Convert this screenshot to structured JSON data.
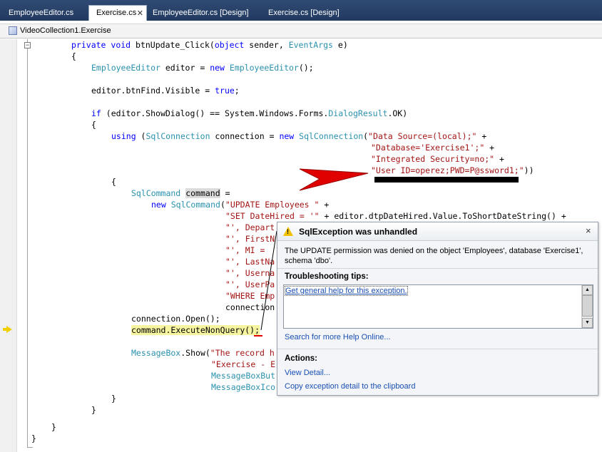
{
  "tabs": [
    {
      "label": "EmployeeEditor.cs",
      "active": false
    },
    {
      "label": "Exercise.cs",
      "active": true
    },
    {
      "label": "EmployeeEditor.cs [Design]",
      "active": false
    },
    {
      "label": "Exercise.cs [Design]",
      "active": false
    }
  ],
  "navbar": {
    "member": "VideoCollection1.Exercise"
  },
  "code": {
    "l01": {
      "a": "private",
      "b": "void",
      "c": " btnUpdate_Click(",
      "d": "object",
      "e": " sender, ",
      "f": "EventArgs",
      "g": " e)"
    },
    "l02": "{",
    "l03": {
      "a": "EmployeeEditor",
      "b": " editor = ",
      "c": "new",
      "d": " ",
      "e": "EmployeeEditor",
      "f": "();"
    },
    "l04": {
      "a": "editor.btnFind.Visible = ",
      "b": "true",
      "c": ";"
    },
    "l05": {
      "a": "if",
      "b": " (editor.ShowDialog() == System.Windows.Forms.",
      "c": "DialogResult",
      "d": ".OK)"
    },
    "l06": "{",
    "l07": {
      "a": "using",
      "b": " (",
      "c": "SqlConnection",
      "d": " connection = ",
      "e": "new",
      "f": " ",
      "g": "SqlConnection",
      "h": "(",
      "i": "\"Data Source=(local);\"",
      "j": " +"
    },
    "l08": {
      "a": "\"Database='Exercise1';\"",
      "b": " +"
    },
    "l09": {
      "a": "\"Integrated Security=no;\"",
      "b": " +"
    },
    "l10": {
      "a": "\"User ID=operez;PWD=P@ssword1;\"",
      "b": "))"
    },
    "l11": "{",
    "l12": {
      "a": "SqlCommand",
      "b": " ",
      "c": "command",
      "d": " ="
    },
    "l13": {
      "a": "new",
      "b": " ",
      "c": "SqlCommand",
      "d": "(",
      "e": "\"UPDATE Employees \"",
      "f": " +"
    },
    "l14": {
      "a": "\"SET DateHired = '\"",
      "b": " + editor.dtpDateHired.Value.ToShortDateString() +"
    },
    "l15": "\"', Depart",
    "l16": "\"', FirstN",
    "l17": "\"', MI = ",
    "l18": "\"', LastNa",
    "l19": "\"', Userna",
    "l20": "\"', UserPa",
    "l21": "\"WHERE Emp",
    "l22": "connection",
    "l23": "connection.Open();",
    "l24": {
      "a": "command",
      "b": ".ExecuteNonQuery();"
    },
    "l25": {
      "a": "MessageBox",
      "b": ".Show(",
      "c": "\"The record h"
    },
    "l26": "\"Exercise - E",
    "l27": "MessageBoxBut",
    "l28": "MessageBoxIco",
    "l29": "}",
    "l30": "}",
    "l31": "}",
    "l32": "}"
  },
  "dialog": {
    "title": "SqlException was unhandled",
    "close_glyph": "×",
    "message": "The UPDATE permission was denied on the object 'Employees', database 'Exercise1', schema 'dbo'.",
    "tips_heading": "Troubleshooting tips:",
    "tips_link": "Get general help for this exception.",
    "search_link": "Search for more Help Online...",
    "actions_heading": "Actions:",
    "view_detail": "View Detail...",
    "copy_detail": "Copy exception detail to the clipboard"
  },
  "icons": {
    "warning": "warning-icon",
    "pointer": "red-arrow-icon",
    "current_statement": "current-statement-arrow-icon"
  },
  "colors": {
    "keyword": "#0000ff",
    "type": "#2b91af",
    "string": "#a31515",
    "link": "#1a4fb4",
    "arrow": "#e00000",
    "exec_highlight": "#f7f4a0"
  }
}
